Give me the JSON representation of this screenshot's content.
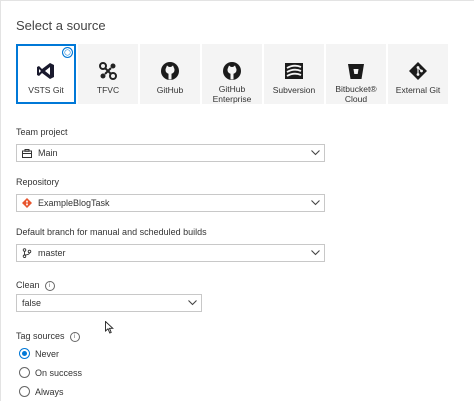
{
  "title": "Select a source",
  "sources": [
    {
      "label": "VSTS Git",
      "icon": "vsts-icon",
      "selected": true
    },
    {
      "label": "TFVC",
      "icon": "tfvc-icon",
      "selected": false
    },
    {
      "label": "GitHub",
      "icon": "github-icon",
      "selected": false
    },
    {
      "label": "GitHub Enterprise",
      "icon": "github-icon",
      "selected": false
    },
    {
      "label": "Subversion",
      "icon": "subversion-icon",
      "selected": false
    },
    {
      "label": "Bitbucket® Cloud",
      "icon": "bitbucket-icon",
      "selected": false
    },
    {
      "label": "External Git",
      "icon": "git-icon",
      "selected": false
    }
  ],
  "team_project": {
    "label": "Team project",
    "value": "Main"
  },
  "repository": {
    "label": "Repository",
    "value": "ExampleBlogTask"
  },
  "default_branch": {
    "label": "Default branch for manual and scheduled builds",
    "value": "master"
  },
  "clean": {
    "label": "Clean",
    "value": "false"
  },
  "tag_sources": {
    "label": "Tag sources",
    "options": [
      "Never",
      "On success",
      "Always"
    ],
    "selected": "Never"
  },
  "colors": {
    "accent": "#0078d7",
    "git_orange": "#e8552e",
    "tile_bg": "#f4f4f4"
  }
}
